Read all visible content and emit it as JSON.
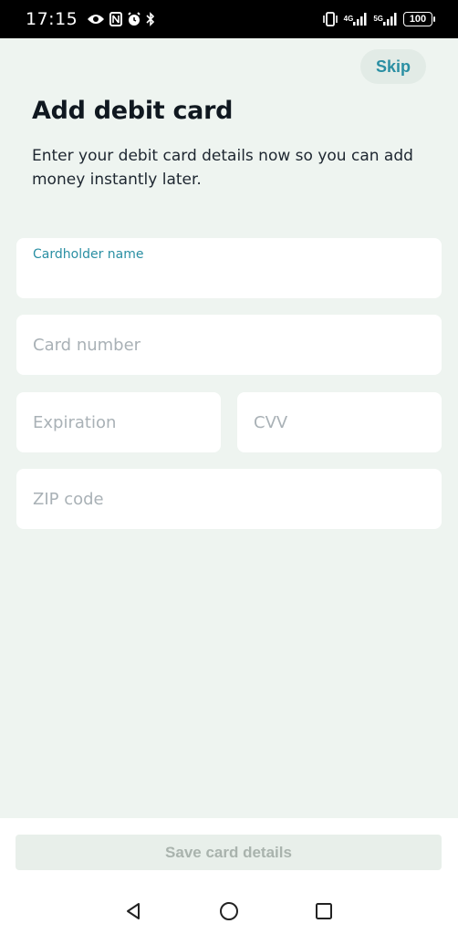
{
  "status_bar": {
    "time": "17:15",
    "network_1": "4G",
    "network_2": "5G",
    "battery": "100",
    "icons": [
      "eye-icon",
      "nfc-icon",
      "alarm-icon",
      "bluetooth-icon",
      "vibrate-icon",
      "signal-icon",
      "battery-icon"
    ]
  },
  "header": {
    "skip_label": "Skip"
  },
  "main": {
    "title": "Add debit card",
    "subtitle": "Enter your debit card details now so you can add money instantly later."
  },
  "form": {
    "cardholder_label": "Cardholder name",
    "cardholder_value": "",
    "card_number_placeholder": "Card number",
    "expiration_placeholder": "Expiration",
    "cvv_placeholder": "CVV",
    "zip_placeholder": "ZIP code"
  },
  "footer": {
    "save_label": "Save card details"
  },
  "colors": {
    "accent": "#2a8fa3",
    "background": "#eef4f0",
    "title": "#101820",
    "disabled_button": "#e8efea"
  }
}
